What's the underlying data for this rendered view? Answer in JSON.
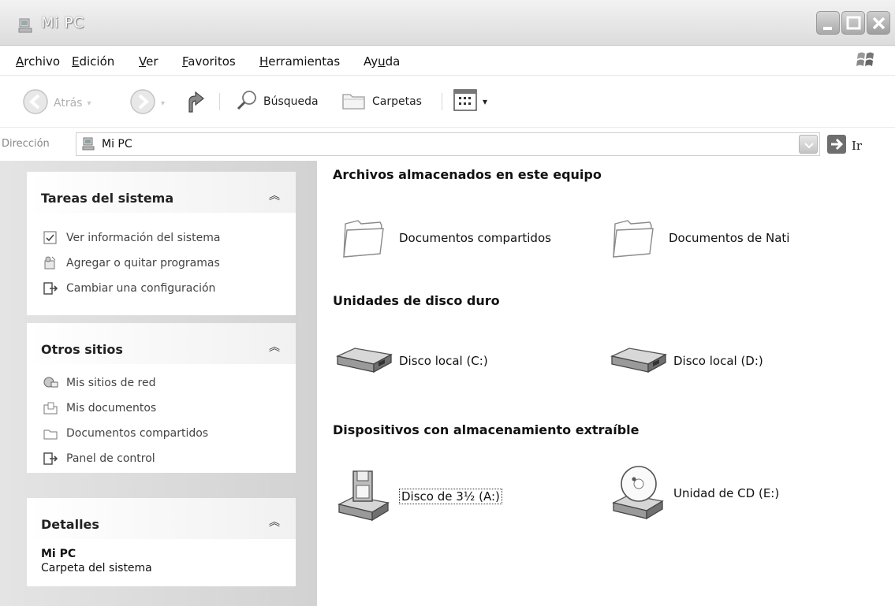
{
  "window": {
    "title": "Mi PC"
  },
  "menu": [
    "Archivo",
    "Edición",
    "Ver",
    "Favoritos",
    "Herramientas",
    "Ayuda"
  ],
  "toolbar": {
    "back": "Atrás",
    "search": "Búsqueda",
    "folders": "Carpetas"
  },
  "address": {
    "label": "Dirección",
    "value": "Mi PC",
    "go": "Ir"
  },
  "left": {
    "system_tasks": {
      "title": "Tareas del sistema",
      "items": [
        "Ver información del sistema",
        "Agregar o quitar programas",
        "Cambiar una configuración"
      ]
    },
    "other_places": {
      "title": "Otros sitios",
      "items": [
        "Mis sitios de red",
        "Mis documentos",
        "Documentos compartidos",
        "Panel de control"
      ]
    },
    "details": {
      "title": "Detalles",
      "name": "Mi PC",
      "desc": "Carpeta del sistema"
    }
  },
  "content": {
    "sections": [
      {
        "title": "Archivos almacenados en este equipo",
        "items": [
          "Documentos compartidos",
          "Documentos de Nati"
        ]
      },
      {
        "title": "Unidades de disco duro",
        "items": [
          "Disco local (C:)",
          "Disco local (D:)"
        ]
      },
      {
        "title": "Dispositivos con almacenamiento extraíble",
        "items": [
          "Disco de 3½ (A:)",
          "Unidad de CD (E:)"
        ]
      }
    ]
  }
}
